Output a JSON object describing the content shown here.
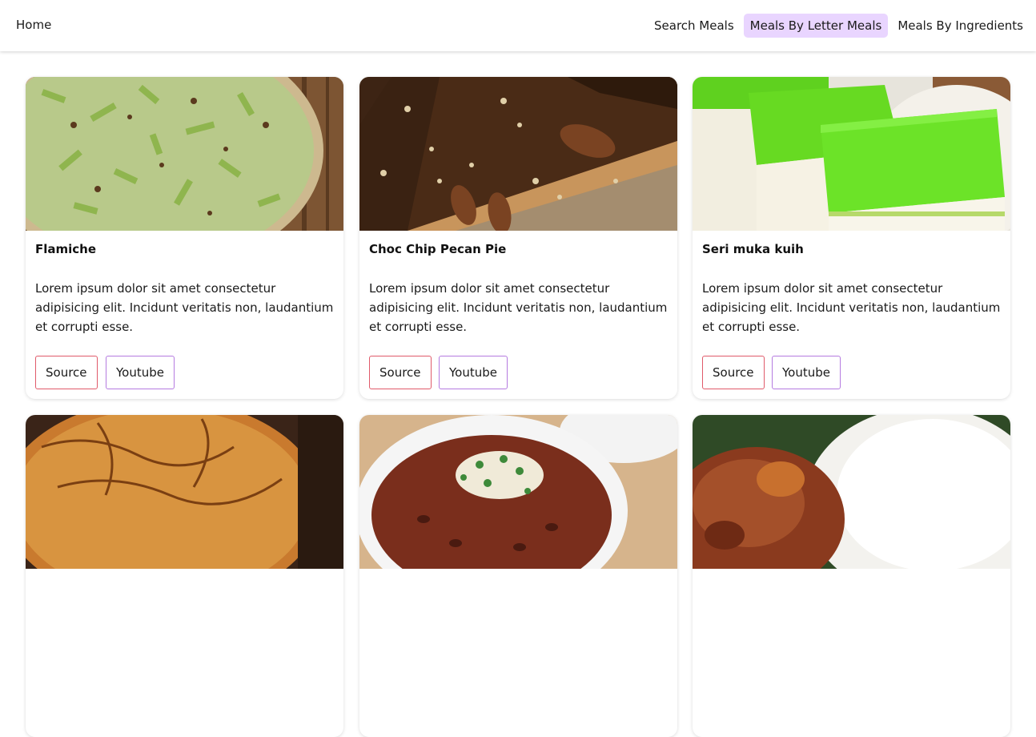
{
  "nav": {
    "home": "Home",
    "links": [
      "Search Meals",
      "Meals By Letter Meals",
      "Meals By Ingredients"
    ],
    "active_index": 1,
    "active_color": "#e9d5ff"
  },
  "meals": [
    {
      "title": "Flamiche",
      "description": "Lorem ipsum dolor sit amet consectetur adipisicing elit. Incidunt veritatis non, laudantium et corrupti esse.",
      "source_label": "Source",
      "youtube_label": "Youtube"
    },
    {
      "title": "Choc Chip Pecan Pie",
      "description": "Lorem ipsum dolor sit amet consectetur adipisicing elit. Incidunt veritatis non, laudantium et corrupti esse.",
      "source_label": "Source",
      "youtube_label": "Youtube"
    },
    {
      "title": "Seri muka kuih",
      "description": "Lorem ipsum dolor sit amet consectetur adipisicing elit. Incidunt veritatis non, laudantium et corrupti esse.",
      "source_label": "Source",
      "youtube_label": "Youtube"
    }
  ],
  "colors": {
    "source_border": "#e05a6a",
    "youtube_border": "#b57be0"
  }
}
